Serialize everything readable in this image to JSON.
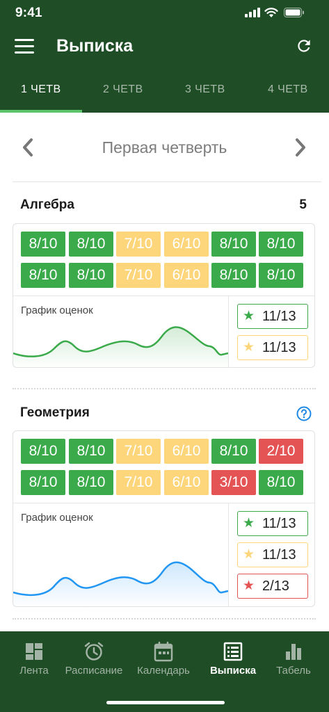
{
  "status": {
    "time": "9:41"
  },
  "appbar": {
    "title": "Выписка"
  },
  "tabs": [
    {
      "label": "1 ЧЕТВ"
    },
    {
      "label": "2 ЧЕТВ"
    },
    {
      "label": "3 ЧЕТВ"
    },
    {
      "label": "4 ЧЕТВ"
    }
  ],
  "active_tab": 0,
  "quarter_nav": {
    "title": "Первая четверть"
  },
  "subjects": [
    {
      "name": "Алгебра",
      "average": "5",
      "grades": [
        "8/10",
        "8/10",
        "7/10",
        "6/10",
        "8/10",
        "8/10",
        "8/10",
        "8/10",
        "7/10",
        "6/10",
        "8/10",
        "8/10"
      ],
      "grade_levels": [
        "good",
        "good",
        "mid",
        "mid",
        "good",
        "good",
        "good",
        "good",
        "mid",
        "mid",
        "good",
        "good"
      ],
      "chart_label": "График оценок",
      "stats": [
        {
          "value": "11/13",
          "level": "good"
        },
        {
          "value": "11/13",
          "level": "mid"
        }
      ]
    },
    {
      "name": "Геометрия",
      "average": "",
      "grades": [
        "8/10",
        "8/10",
        "7/10",
        "6/10",
        "8/10",
        "2/10",
        "8/10",
        "8/10",
        "7/10",
        "6/10",
        "3/10",
        "8/10"
      ],
      "grade_levels": [
        "good",
        "good",
        "mid",
        "mid",
        "good",
        "bad",
        "good",
        "good",
        "mid",
        "mid",
        "bad",
        "good"
      ],
      "chart_label": "График оценок",
      "stats": [
        {
          "value": "11/13",
          "level": "good"
        },
        {
          "value": "11/13",
          "level": "mid"
        },
        {
          "value": "2/13",
          "level": "bad"
        }
      ]
    }
  ],
  "bottom_nav": [
    {
      "label": "Лента",
      "icon": "feed-icon"
    },
    {
      "label": "Расписание",
      "icon": "alarm-clock-icon"
    },
    {
      "label": "Календарь",
      "icon": "calendar-icon"
    },
    {
      "label": "Выписка",
      "icon": "statement-icon"
    },
    {
      "label": "Табель",
      "icon": "bar-chart-icon"
    }
  ],
  "active_bottom": 3,
  "colors": {
    "header": "#1e4d26",
    "good": "#3aaa4a",
    "mid": "#fdd57b",
    "bad": "#e45454",
    "accent": "#5cc46b",
    "help": "#1e88e5",
    "chart_green": "#3aaa4a",
    "chart_blue": "#2196f3"
  }
}
